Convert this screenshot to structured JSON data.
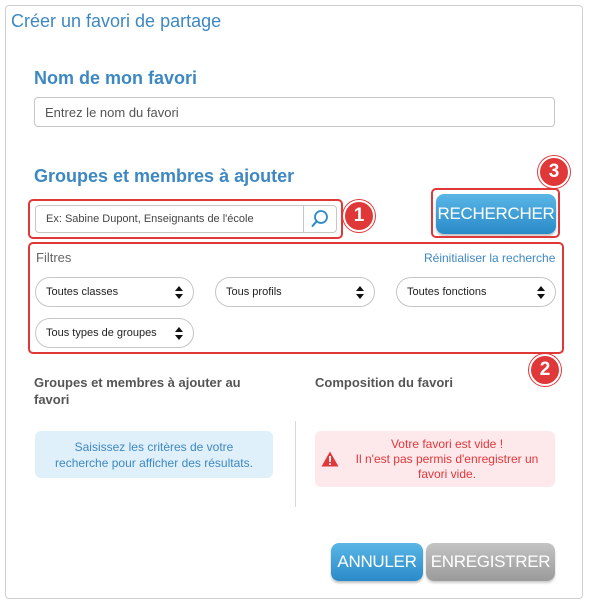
{
  "dialog": {
    "title": "Créer un favori de partage",
    "name_section_title": "Nom de mon favori",
    "name_input_placeholder": "Entrez le nom du favori",
    "groups_section_title": "Groupes et membres à ajouter",
    "search_placeholder": "Ex: Sabine Dupont, Enseignants de l'école",
    "search_button_label": "RECHERCHER",
    "filters": {
      "label": "Filtres",
      "reset_link": "Réinitialiser la recherche",
      "selects": [
        "Toutes classes",
        "Tous profils",
        "Toutes fonctions",
        "Tous types de groupes"
      ]
    },
    "left_column_title": "Groupes et membres à ajouter au favori",
    "right_column_title": "Composition du favori",
    "info_message": "Saisissez les critères de votre recherche pour afficher des résultats.",
    "warning": {
      "line1": "Votre favori est vide !",
      "line2": "Il n'est pas permis d'enregistrer un favori vide."
    },
    "cancel_button_label": "ANNULER",
    "save_button_label": "ENREGISTRER"
  },
  "annotations": [
    "1",
    "2",
    "3"
  ],
  "colors": {
    "accent": "#3e88c2",
    "annotation_red": "#e03838",
    "button_blue": "#2a8ac8",
    "button_grey": "#9a9a9a"
  },
  "icons": [
    "search-icon",
    "chevron-updown-icon",
    "warning-icon"
  ]
}
